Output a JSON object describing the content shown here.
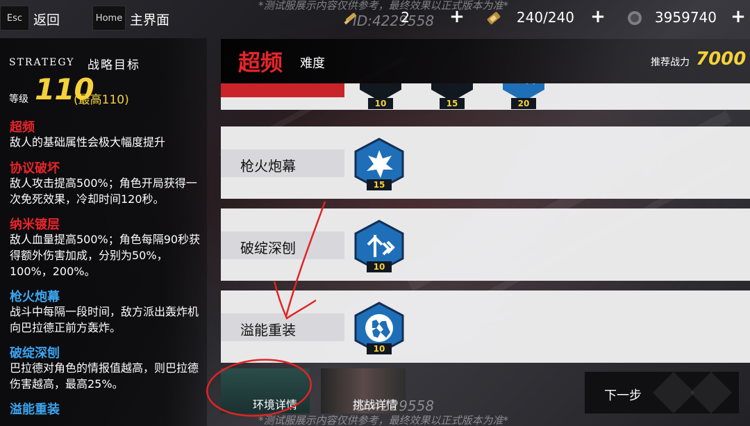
{
  "topbar": {
    "esc_key": "Esc",
    "back_label": "返回",
    "home_key": "Home",
    "home_label": "主界面",
    "watermark_top": "*测试服展示内容仅供参考，最终效果以正式版本为准*",
    "watermark_id": "ID:4229558",
    "resources": [
      {
        "icon": "ammo-icon",
        "value": "2"
      },
      {
        "icon": "battery-icon",
        "value": "240/240"
      },
      {
        "icon": "coin-icon",
        "value": "3959740"
      }
    ]
  },
  "strategy": {
    "title_en": "STRATEGY",
    "title_cn": "战略目标",
    "level_label": "等级",
    "level_value": "110",
    "level_max": "(最高110)"
  },
  "effects": [
    {
      "title": "超频",
      "color": "#e8252b",
      "desc": "敌人的基础属性会极大幅度提升"
    },
    {
      "title": "协议破坏",
      "color": "#e8252b",
      "desc": "敌人攻击提高500%；角色开局获得一次免死效果，冷却时间120秒。"
    },
    {
      "title": "纳米镀层",
      "color": "#e8252b",
      "desc": "敌人血量提高500%；角色每隔90秒获得额外伤害加成，分别为50%，100%，200%。"
    },
    {
      "title": "枪火炮幕",
      "color": "#3ba5f0",
      "desc": "战斗中每隔一段时间，敌方派出轰炸机向巴拉德正前方轰炸。"
    },
    {
      "title": "破绽深刨",
      "color": "#3ba5f0",
      "desc": "巴拉德对角色的情报值越高，则巴拉德伤害越高，最高25%。"
    },
    {
      "title": "溢能重装",
      "color": "#3ba5f0",
      "desc": ""
    }
  ],
  "difficulty": {
    "main": "超频",
    "sub": "难度",
    "power_label": "推荐战力",
    "power_value": "7000"
  },
  "rows": [
    {
      "label": "",
      "badges": [
        {
          "icon": "skull-rank1-icon",
          "num": "10"
        },
        {
          "icon": "skull-rank2-icon",
          "num": "15"
        },
        {
          "icon": "skull-rank3-icon",
          "num": "20"
        }
      ]
    },
    {
      "label": "枪火炮幕",
      "badges": [
        {
          "icon": "explosion-icon",
          "num": "15"
        }
      ]
    },
    {
      "label": "破绽深刨",
      "badges": [
        {
          "icon": "weakpoint-icon",
          "num": "10"
        }
      ]
    },
    {
      "label": "溢能重装",
      "badges": [
        {
          "icon": "armor-shield-icon",
          "num": "10"
        }
      ]
    }
  ],
  "bottom": {
    "env_label": "环境详情",
    "challenge_label": "挑战详情",
    "next_label": "下一步",
    "watermark_bottom": "*测试服展示内容仅供参考，最终效果以正式版本为准*",
    "watermark_id": "ID:4229558"
  },
  "colors": {
    "accent_red": "#e8252b",
    "accent_gold": "#f5d23a",
    "accent_blue": "#3ba5f0",
    "hex_blue": "#1f6fb8"
  }
}
